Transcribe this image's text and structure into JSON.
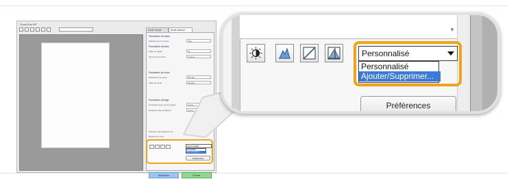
{
  "window": {
    "title": "ScanGear MF",
    "tabs": {
      "basic": "Mode simple",
      "advanced": "Mode avancé"
    },
    "sections": [
      "Paramètres de saisie",
      "Paramètres d'entrée",
      "Paramètres de sortie",
      "Paramètres d'image"
    ],
    "rows": [
      {
        "label": "Sélectionner la source",
        "value": "Vitre"
      },
      {
        "label": "Taille du papier",
        "value": "A4"
      },
      {
        "label": "Type de document",
        "value": "Couleur"
      },
      {
        "label": "Résolution de sortie",
        "value": "300 dpi"
      },
      {
        "label": "Taille de sortie",
        "value": "Flexible"
      },
      {
        "label": "Correction auto. de la tonalité",
        "value": "Activé"
      },
      {
        "label": "Réduction des vibrations",
        "value": "Aucun"
      }
    ],
    "checkboxes": [
      "Détecter automatiquement",
      "Réduire la moire"
    ],
    "buttons": {
      "scan": "Numériser",
      "close": "Fermer"
    }
  },
  "callout": {
    "tools": [
      {
        "icon": "brightness-contrast-icon"
      },
      {
        "icon": "histogram-icon"
      },
      {
        "icon": "tone-curve-icon"
      },
      {
        "icon": "threshold-icon"
      }
    ],
    "tone_select": {
      "value": "Personnalisé",
      "options": [
        "Personnalisé",
        "Ajouter/Supprimer..."
      ],
      "highlighted": "Ajouter/Supprimer..."
    },
    "preferences_label": "Préférences",
    "highlight_color": "#f0a21a"
  }
}
